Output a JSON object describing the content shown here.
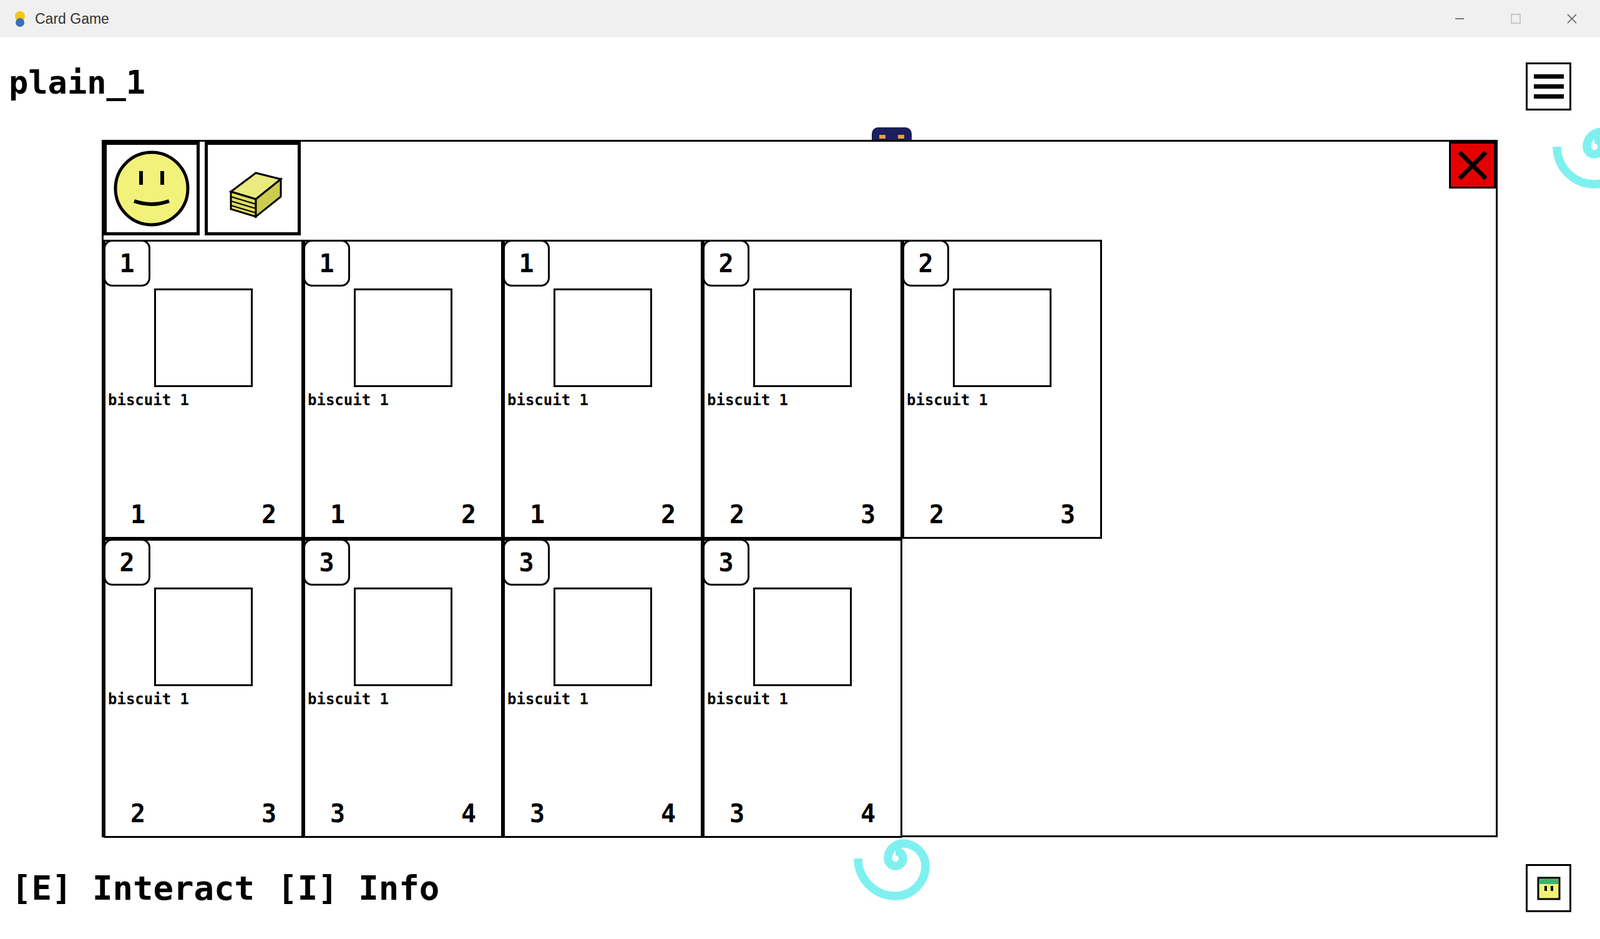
{
  "window": {
    "title": "Card Game"
  },
  "location": "plain_1",
  "cards": [
    {
      "cost": "1",
      "name": "biscuit 1",
      "attack": "1",
      "health": "2"
    },
    {
      "cost": "1",
      "name": "biscuit 1",
      "attack": "1",
      "health": "2"
    },
    {
      "cost": "1",
      "name": "biscuit 1",
      "attack": "1",
      "health": "2"
    },
    {
      "cost": "2",
      "name": "biscuit 1",
      "attack": "2",
      "health": "3"
    },
    {
      "cost": "2",
      "name": "biscuit 1",
      "attack": "2",
      "health": "3"
    },
    {
      "cost": "2",
      "name": "biscuit 1",
      "attack": "2",
      "health": "3"
    },
    {
      "cost": "3",
      "name": "biscuit 1",
      "attack": "3",
      "health": "4"
    },
    {
      "cost": "3",
      "name": "biscuit 1",
      "attack": "3",
      "health": "4"
    },
    {
      "cost": "3",
      "name": "biscuit 1",
      "attack": "3",
      "health": "4"
    }
  ],
  "hints": [
    "[E] Interact",
    "[I] Info"
  ]
}
